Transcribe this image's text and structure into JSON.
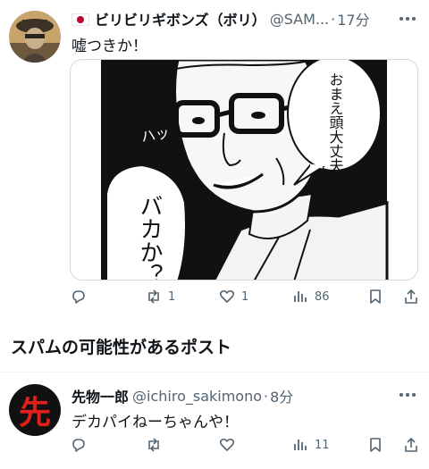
{
  "post1": {
    "flag_icon": "japan-flag-icon",
    "display_name": "ビリビリギボンズ（ボリ）",
    "handle": "@SAM...",
    "separator": "·",
    "time": "17分",
    "text": "嘘つきか！",
    "manga": {
      "bubble_top": "おまえ頭大丈夫か？",
      "bubble_left": "バカか？",
      "sfx": "ハッ"
    },
    "actions": {
      "reply_count": "",
      "repost_count": "1",
      "like_count": "1",
      "views_count": "86"
    }
  },
  "spam_section": {
    "title": "スパムの可能性があるポスト"
  },
  "post2": {
    "avatar_char": "先",
    "display_name": "先物一郎",
    "handle": "@ichiro_sakimono",
    "separator": "·",
    "time": "8分",
    "text": "デカパイねーちゃんや！",
    "actions": {
      "reply_count": "",
      "repost_count": "",
      "like_count": "",
      "views_count": "11"
    }
  },
  "colors": {
    "text": "#0f1419",
    "muted": "#536471",
    "border": "#cfd9de",
    "avatar2_bg": "#111111",
    "avatar2_char": "#e0201b"
  }
}
